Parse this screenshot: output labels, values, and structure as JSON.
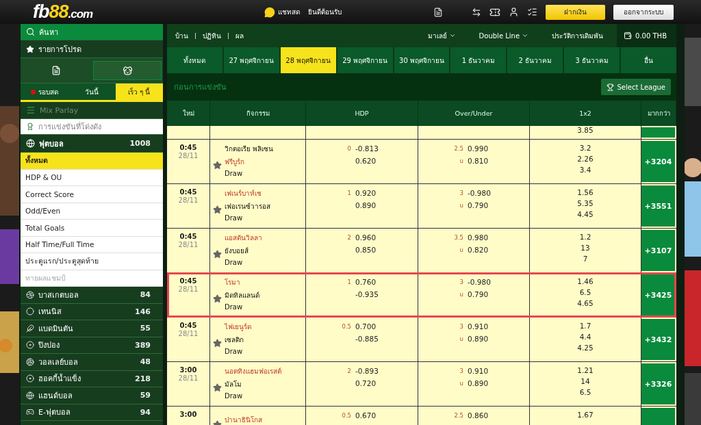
{
  "header": {
    "logo": {
      "main": "fb88",
      "suffix": ".com"
    },
    "chat": "แชทสด",
    "welcome": "ยินดีต้อนรับ",
    "deposit": "ฝากเงิน",
    "logout": "ออกจากระบบ"
  },
  "sidebar": {
    "search": "ค้นหา",
    "favorites": "รายการโปรด",
    "view_toggle": [
      {
        "selected": false
      },
      {
        "selected": true
      }
    ],
    "time_tabs": [
      {
        "label": "รอบสด",
        "live": true,
        "selected": false
      },
      {
        "label": "วันนี้",
        "live": false,
        "selected": false
      },
      {
        "label": "เร็ว ๆ นี้",
        "live": false,
        "selected": true
      }
    ],
    "mix_parlay": {
      "label": "Mix Parlay",
      "disabled": true
    },
    "popular": "การแข่งขันที่โด่งดัง",
    "football": {
      "label": "ฟุตบอล",
      "count": "1008"
    },
    "markets": [
      {
        "label": "ทั้งหมด",
        "selected": true,
        "disabled": false
      },
      {
        "label": "HDP & OU",
        "selected": false,
        "disabled": false
      },
      {
        "label": "Correct Score",
        "selected": false,
        "disabled": false
      },
      {
        "label": "Odd/Even",
        "selected": false,
        "disabled": false
      },
      {
        "label": "Total Goals",
        "selected": false,
        "disabled": false
      },
      {
        "label": "Half Time/Full Time",
        "selected": false,
        "disabled": false
      },
      {
        "label": "ประตูแรก/ประตูสุดท้าย",
        "selected": false,
        "disabled": false
      },
      {
        "label": "ทายผลแชมป์",
        "selected": false,
        "disabled": true
      }
    ],
    "sports": [
      {
        "label": "บาสเกตบอล",
        "count": "84"
      },
      {
        "label": "เทนนิส",
        "count": "146"
      },
      {
        "label": "แบดมินตัน",
        "count": "55"
      },
      {
        "label": "ปิงปอง",
        "count": "389"
      },
      {
        "label": "วอลเลย์บอล",
        "count": "48"
      },
      {
        "label": "ฮอคกี้น้ำแข็ง",
        "count": "218"
      },
      {
        "label": "แฮนด์บอล",
        "count": "59"
      },
      {
        "label": "E-ฟุตบอล",
        "count": "94"
      }
    ]
  },
  "topnav": {
    "links": [
      "บ้าน",
      "ปฏิทิน",
      "ผล"
    ],
    "odds_type": "มาเลย์",
    "display": "Double Line",
    "history": "ประวัติการเดิมพัน",
    "balance": "0.00 THB"
  },
  "date_tabs": [
    {
      "label": "ทั้งหมด",
      "selected": false
    },
    {
      "label": "27 พฤศจิกายน",
      "selected": false
    },
    {
      "label": "28 พฤศจิกายน",
      "selected": true
    },
    {
      "label": "29 พฤศจิกายน",
      "selected": false
    },
    {
      "label": "30 พฤศจิกายน",
      "selected": false
    },
    {
      "label": "1 ธันวาคม",
      "selected": false
    },
    {
      "label": "2 ธันวาคม",
      "selected": false
    },
    {
      "label": "3 ธันวาคม",
      "selected": false
    },
    {
      "label": "อื่น",
      "selected": false
    }
  ],
  "section": {
    "title": "ก่อนการแข่งขัน",
    "select_league": "Select League"
  },
  "table": {
    "columns": [
      "ใหม่",
      "กิจกรรม",
      "HDP",
      "Over/Under",
      "1x2",
      "มากกว่า"
    ],
    "rows": [
      {
        "kind": "partial",
        "odds": [
          "3.85"
        ],
        "highlighted": false
      },
      {
        "kind": "match",
        "time": "0:45",
        "date": "28/11",
        "teams": [
          {
            "name": "วิกตอเรีย พลิเซน",
            "favorite": false
          },
          {
            "name": "ฟรีบูร์ก",
            "favorite": true
          }
        ],
        "draw": "Draw",
        "hdp": [
          {
            "line": "0",
            "odds": "-0.813"
          },
          {
            "odds": "0.620"
          }
        ],
        "ou": [
          {
            "line": "2.5",
            "odds": "0.990"
          },
          {
            "line": "u",
            "odds": "0.810"
          }
        ],
        "odds": [
          "3.2",
          "2.26",
          "3.4"
        ],
        "more": "+3204",
        "highlighted": false
      },
      {
        "kind": "match",
        "time": "0:45",
        "date": "28/11",
        "teams": [
          {
            "name": "เฟเนร์บาห์เช",
            "favorite": true
          },
          {
            "name": "เฟอเรนซ์วารอส",
            "favorite": false
          }
        ],
        "draw": "Draw",
        "hdp": [
          {
            "line": "1",
            "odds": "0.920"
          },
          {
            "odds": "0.890"
          }
        ],
        "ou": [
          {
            "line": "3",
            "odds": "-0.980"
          },
          {
            "line": "u",
            "odds": "0.790"
          }
        ],
        "odds": [
          "1.56",
          "5.35",
          "4.45"
        ],
        "more": "+3551",
        "highlighted": false
      },
      {
        "kind": "match",
        "time": "0:45",
        "date": "28/11",
        "teams": [
          {
            "name": "แอสตันวิลลา",
            "favorite": true
          },
          {
            "name": "ยังบอยส์",
            "favorite": false
          }
        ],
        "draw": "Draw",
        "hdp": [
          {
            "line": "2",
            "odds": "0.960"
          },
          {
            "odds": "0.850"
          }
        ],
        "ou": [
          {
            "line": "3.5",
            "odds": "0.980"
          },
          {
            "line": "u",
            "odds": "0.820"
          }
        ],
        "odds": [
          "1.2",
          "13",
          "7"
        ],
        "more": "+3107",
        "highlighted": false
      },
      {
        "kind": "match",
        "time": "0:45",
        "date": "28/11",
        "teams": [
          {
            "name": "โรมา",
            "favorite": true
          },
          {
            "name": "มิดทิลแลนด์",
            "favorite": false
          }
        ],
        "draw": "Draw",
        "hdp": [
          {
            "line": "1",
            "odds": "0.760"
          },
          {
            "odds": "-0.935"
          }
        ],
        "ou": [
          {
            "line": "3",
            "odds": "-0.980"
          },
          {
            "line": "u",
            "odds": "0.790"
          }
        ],
        "odds": [
          "1.46",
          "6.5",
          "4.65"
        ],
        "more": "+3425",
        "highlighted": true
      },
      {
        "kind": "match",
        "time": "0:45",
        "date": "28/11",
        "teams": [
          {
            "name": "ไฟเยนูร์ด",
            "favorite": true
          },
          {
            "name": "เซลติก",
            "favorite": false
          }
        ],
        "draw": "Draw",
        "hdp": [
          {
            "line": "0.5",
            "odds": "0.700"
          },
          {
            "odds": "-0.885"
          }
        ],
        "ou": [
          {
            "line": "3",
            "odds": "0.910"
          },
          {
            "line": "u",
            "odds": "0.890"
          }
        ],
        "odds": [
          "1.7",
          "4.4",
          "4.25"
        ],
        "more": "+3432",
        "highlighted": false
      },
      {
        "kind": "match",
        "time": "3:00",
        "date": "28/11",
        "teams": [
          {
            "name": "นอตทิงแฮมฟอเรสต์",
            "favorite": true
          },
          {
            "name": "มัลโม",
            "favorite": false
          }
        ],
        "draw": "Draw",
        "hdp": [
          {
            "line": "2",
            "odds": "-0.893"
          },
          {
            "odds": "0.720"
          }
        ],
        "ou": [
          {
            "line": "3",
            "odds": "0.910"
          },
          {
            "line": "u",
            "odds": "0.890"
          }
        ],
        "odds": [
          "1.21",
          "14",
          "6.5"
        ],
        "more": "+3326",
        "highlighted": false
      },
      {
        "kind": "match",
        "time": "3:00",
        "teams": [
          {
            "name": "ปานาธินิโกส",
            "favorite": true
          }
        ],
        "hdp": [
          {
            "line": "0.5",
            "odds": "0.670"
          }
        ],
        "ou": [
          {
            "line": "2.5",
            "odds": "0.860"
          }
        ],
        "odds": [
          "1.67"
        ],
        "highlighted": false
      }
    ]
  }
}
